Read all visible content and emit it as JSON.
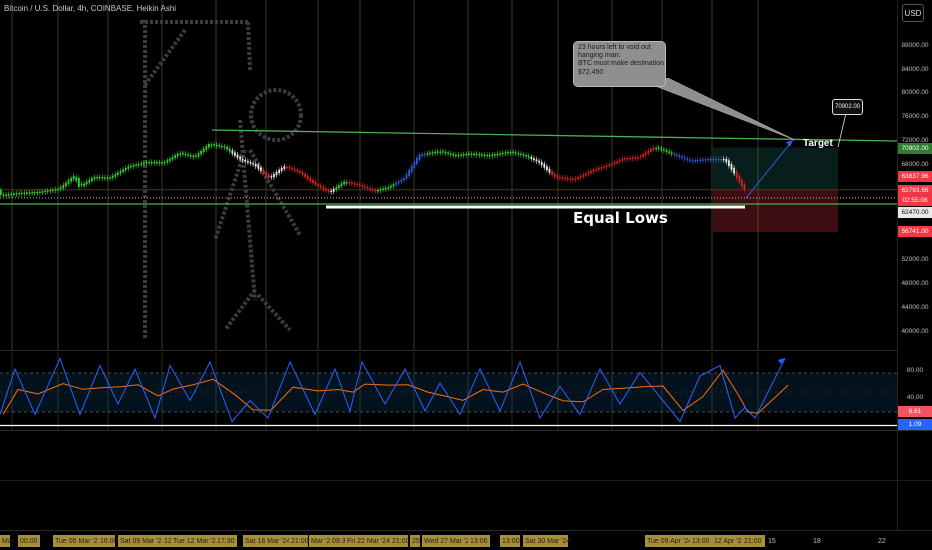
{
  "header": {
    "title": "Bitcoin / U.S. Dollar, 4h, COINBASE, Heikin Ashi",
    "currency_button": "USD"
  },
  "annotations": {
    "note_lines": [
      "23 hours left to void out",
      "hanging man:",
      "BTC must make destination",
      "$72,450"
    ],
    "target_box": "70902.00",
    "target_label": "Target",
    "equal_lows_label": "Equal Lows"
  },
  "price_axis": {
    "ticks": [
      "88000.00",
      "84000.00",
      "80000.00",
      "76000.00",
      "72000.00",
      "68000.00",
      "52000.00",
      "48000.00",
      "44000.00",
      "40000.00"
    ]
  },
  "price_labels": [
    {
      "text": "70902.00",
      "bg": "#2e7d32",
      "fg": "#ffffff"
    },
    {
      "text": "63837.96",
      "bg": "#f23645",
      "fg": "#ffffff"
    },
    {
      "text": "63793.66",
      "bg": "#f23645",
      "fg": "#ffffff"
    },
    {
      "text": "02:55:08",
      "bg": "#f23645",
      "fg": "#ffffff"
    },
    {
      "text": "62470.00",
      "bg": "#e8e8e8",
      "fg": "#111111"
    },
    {
      "text": "56741.00",
      "bg": "#f23645",
      "fg": "#ffffff"
    }
  ],
  "osc_axis": {
    "ticks": [
      "80.00",
      "40.00"
    ],
    "labels": [
      {
        "text": "8.61",
        "bg": "#f7525f",
        "fg": "#ffffff"
      },
      {
        "text": "1.09",
        "bg": "#2962ff",
        "fg": "#ffffff"
      }
    ]
  },
  "time_axis": {
    "labels": [
      {
        "text": "Mar",
        "hl": true
      },
      {
        "text": "00:00",
        "hl": true
      },
      {
        "text": "Tue 05 Mar '24",
        "hl": true
      },
      {
        "text": "16:00",
        "hl": true
      },
      {
        "text": "Sat 09 Mar '24",
        "hl": true
      },
      {
        "text": "12",
        "hl": true
      },
      {
        "text": "Tue 12 Mar '24",
        "hl": true
      },
      {
        "text": "17:30",
        "hl": true
      },
      {
        "text": "Sat 16 Mar '24",
        "hl": true
      },
      {
        "text": "21:00",
        "hl": true
      },
      {
        "text": "Mar '24",
        "hl": true
      },
      {
        "text": "09:3",
        "hl": true
      },
      {
        "text": "Fri 22 Mar '24",
        "hl": true
      },
      {
        "text": "21:00",
        "hl": true
      },
      {
        "text": "25",
        "hl": true
      },
      {
        "text": "Wed 27 Mar '24",
        "hl": true
      },
      {
        "text": "13:06",
        "hl": true
      },
      {
        "text": "13:00",
        "hl": true
      },
      {
        "text": "Sat 30 Mar '24",
        "hl": true
      },
      {
        "text": "Tue 09 Apr '24",
        "hl": true
      },
      {
        "text": "13:00",
        "hl": true
      },
      {
        "text": "12 Apr '24",
        "hl": true
      },
      {
        "text": "21:00",
        "hl": true
      },
      {
        "text": "15",
        "hl": false
      },
      {
        "text": "18",
        "hl": false
      },
      {
        "text": "22",
        "hl": false
      }
    ]
  },
  "colors": {
    "bull": "#26a69a",
    "green": "#2bd52b",
    "red": "#e01e1e",
    "blue": "#2e5bd8",
    "white": "#e8e8e8",
    "trend": "#4caf50",
    "stoch_k": "#2962ff",
    "stoch_d": "#ff6d00"
  },
  "chart_data": {
    "type": "candlestick",
    "interval": "4h",
    "y_price_range": [
      36000,
      92000
    ],
    "price_levels": {
      "target": 70902.0,
      "entry": 63837.96,
      "last": 63793.66,
      "equal_lows": 62470.0,
      "stop": 56741.0
    },
    "price_path": [
      [
        0,
        62900
      ],
      [
        20,
        63300
      ],
      [
        40,
        63500
      ],
      [
        60,
        64000
      ],
      [
        75,
        66200
      ],
      [
        80,
        64300
      ],
      [
        95,
        66000
      ],
      [
        110,
        65800
      ],
      [
        130,
        67800
      ],
      [
        150,
        68500
      ],
      [
        165,
        68400
      ],
      [
        180,
        70000
      ],
      [
        195,
        69300
      ],
      [
        210,
        71500
      ],
      [
        225,
        71000
      ],
      [
        240,
        69000
      ],
      [
        255,
        68000
      ],
      [
        270,
        65800
      ],
      [
        285,
        67800
      ],
      [
        300,
        66800
      ],
      [
        315,
        64800
      ],
      [
        330,
        63400
      ],
      [
        345,
        65200
      ],
      [
        360,
        64600
      ],
      [
        375,
        63600
      ],
      [
        390,
        64300
      ],
      [
        405,
        65800
      ],
      [
        420,
        69700
      ],
      [
        440,
        70300
      ],
      [
        455,
        69600
      ],
      [
        470,
        69900
      ],
      [
        490,
        69600
      ],
      [
        510,
        70200
      ],
      [
        525,
        69600
      ],
      [
        540,
        68400
      ],
      [
        555,
        66000
      ],
      [
        575,
        65600
      ],
      [
        595,
        67200
      ],
      [
        610,
        68000
      ],
      [
        625,
        69100
      ],
      [
        640,
        69300
      ],
      [
        655,
        71000
      ],
      [
        670,
        70000
      ],
      [
        690,
        68700
      ],
      [
        710,
        69000
      ],
      [
        725,
        69000
      ],
      [
        735,
        66600
      ],
      [
        745,
        63800
      ]
    ],
    "stoch_k": [
      [
        0,
        15
      ],
      [
        15,
        80
      ],
      [
        35,
        15
      ],
      [
        60,
        95
      ],
      [
        80,
        15
      ],
      [
        100,
        85
      ],
      [
        118,
        30
      ],
      [
        135,
        80
      ],
      [
        155,
        10
      ],
      [
        170,
        85
      ],
      [
        190,
        35
      ],
      [
        210,
        90
      ],
      [
        232,
        5
      ],
      [
        250,
        35
      ],
      [
        268,
        10
      ],
      [
        290,
        90
      ],
      [
        315,
        15
      ],
      [
        335,
        80
      ],
      [
        350,
        20
      ],
      [
        362,
        90
      ],
      [
        385,
        30
      ],
      [
        405,
        80
      ],
      [
        425,
        20
      ],
      [
        440,
        60
      ],
      [
        460,
        15
      ],
      [
        480,
        80
      ],
      [
        500,
        20
      ],
      [
        520,
        90
      ],
      [
        540,
        10
      ],
      [
        560,
        55
      ],
      [
        580,
        15
      ],
      [
        600,
        80
      ],
      [
        620,
        30
      ],
      [
        640,
        75
      ],
      [
        660,
        40
      ],
      [
        680,
        5
      ],
      [
        700,
        70
      ],
      [
        720,
        85
      ],
      [
        735,
        10
      ],
      [
        745,
        25
      ],
      [
        755,
        10
      ],
      [
        785,
        95
      ]
    ]
  }
}
